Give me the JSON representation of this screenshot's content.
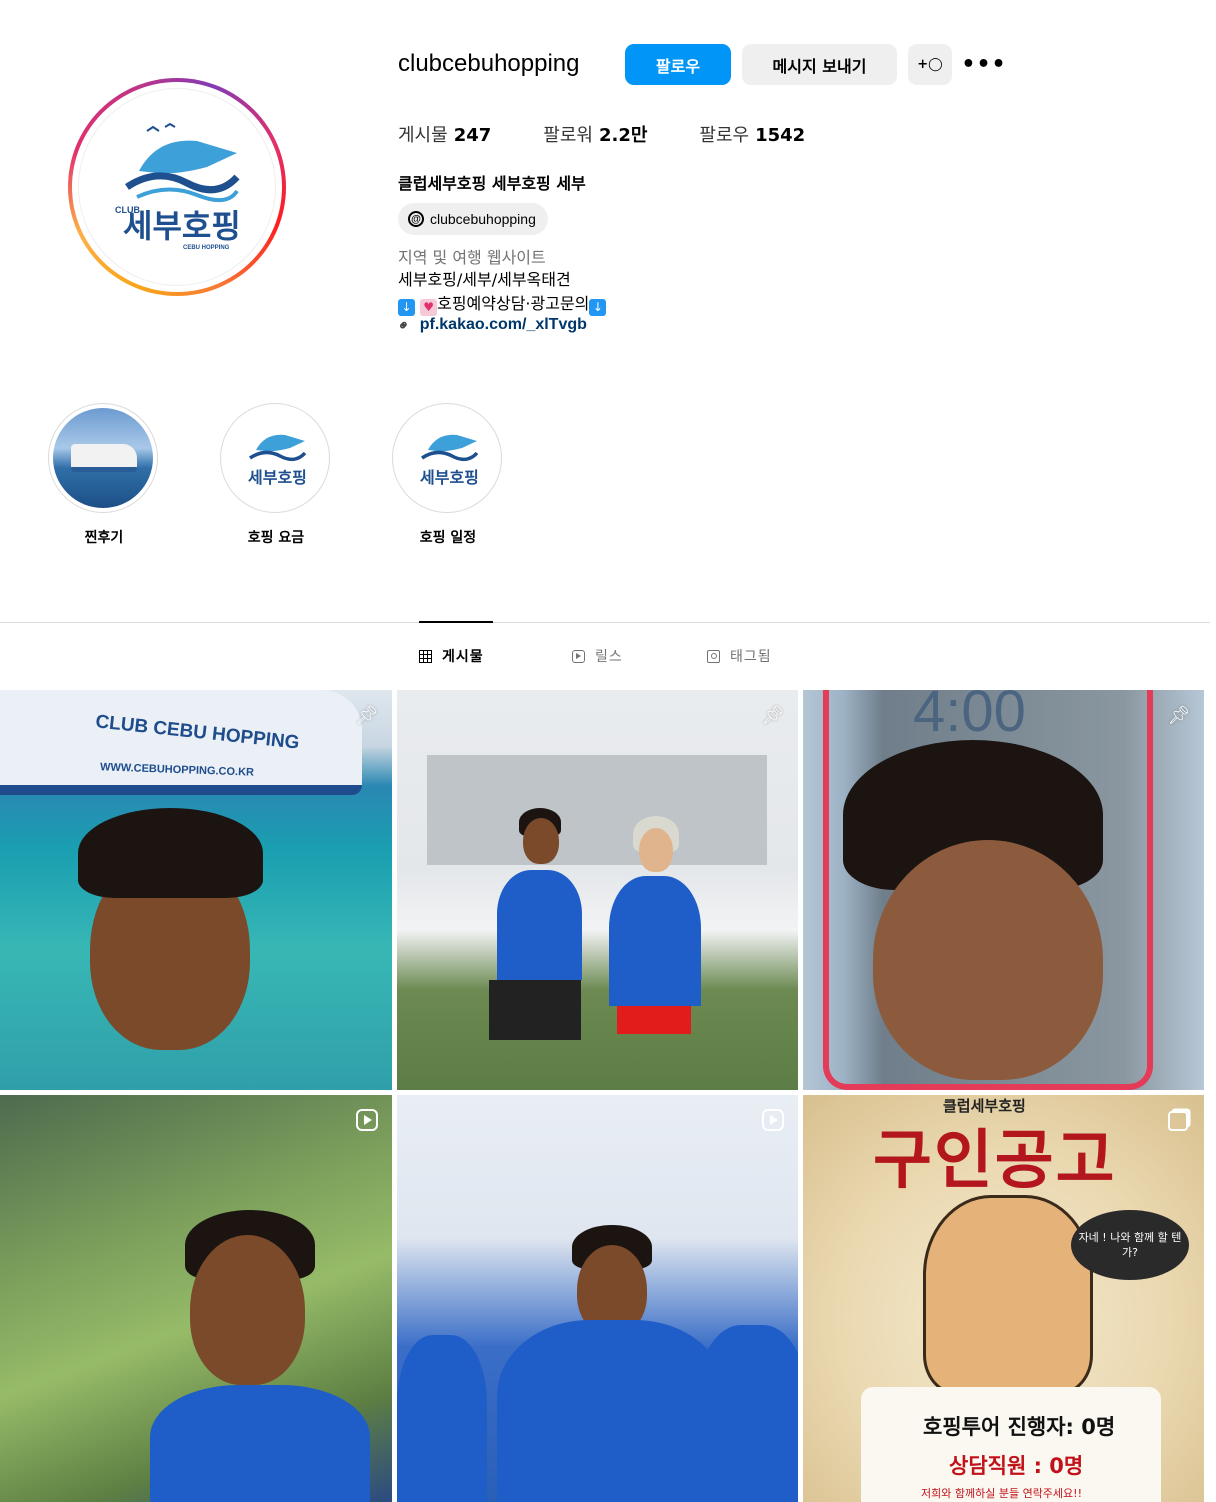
{
  "profile": {
    "username": "clubcebuhopping",
    "follow_label": "팔로우",
    "message_label": "메시지 보내기",
    "add_icon": "add-person-icon",
    "more_icon": "more-options-icon",
    "stats": [
      {
        "label": "게시물",
        "value": "247"
      },
      {
        "label": "팔로워",
        "value": "2.2만"
      },
      {
        "label": "팔로우",
        "value": "1542"
      }
    ],
    "full_name": "클럽세부호핑 세부호핑 세부",
    "threads_handle": "clubcebuhopping",
    "category": "지역 및 여행 웹사이트",
    "bio_line1": "세부호핑/세부/세부옥태견",
    "bio_line2": "호핑예약상담·광고문의",
    "link": "pf.kakao.com/_xlTvgb",
    "logo_club": "CLUB",
    "logo_korean": "세부호핑",
    "logo_english": "CEBU HOPPING"
  },
  "highlights": [
    {
      "label": "찐후기"
    },
    {
      "label": "호핑 요금"
    },
    {
      "label": "호핑 일정"
    }
  ],
  "tabs": [
    {
      "label": "게시물",
      "active": true
    },
    {
      "label": "릴스",
      "active": false
    },
    {
      "label": "태그됨",
      "active": false
    }
  ],
  "posts": {
    "p1_ship_text": "CLUB CEBU HOPPING",
    "p1_ship_url": "WWW.CEBUHOPPING.CO.KR",
    "p3_time": "4:00",
    "p6_top": "클럽세부호핑",
    "p6_title": "구인공고",
    "p6_bubble": "자네 ! 나와 함께 할 텐가?",
    "p6_line1": "호핑투어 진행자: 0명",
    "p6_line2": "상담직원 : 0명",
    "p6_line3": "저희와 함께하실 분들 연락주세요!!"
  },
  "colors": {
    "accent": "#0095f6",
    "link": "#00376b",
    "secondary_text": "#737373"
  }
}
